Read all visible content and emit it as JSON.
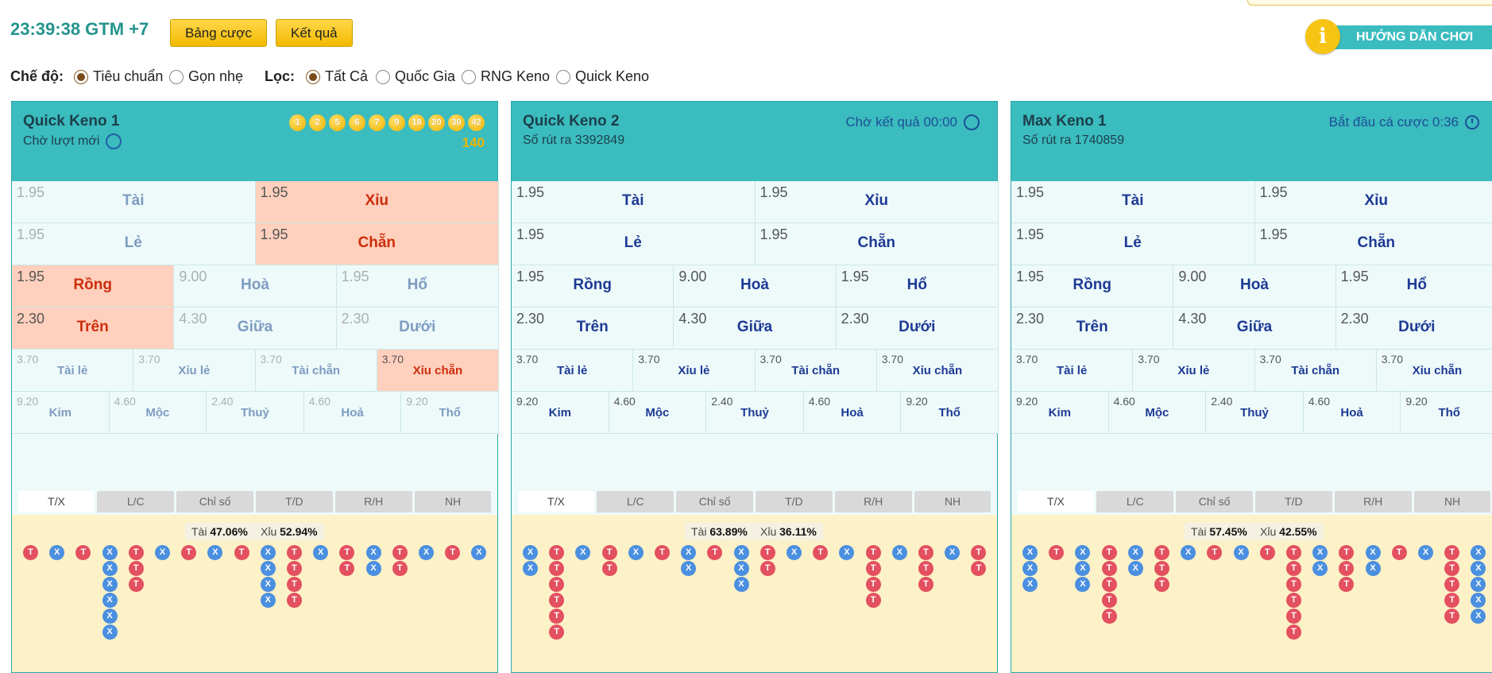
{
  "header": {
    "clock": "23:39:38 GTM +7",
    "bet_table_label": "Bảng cược",
    "results_label": "Kết quả",
    "help_label": "HƯỚNG DẪN CHƠI",
    "help_icon_glyph": "i"
  },
  "filters": {
    "mode_label": "Chế độ:",
    "mode_options": [
      {
        "label": "Tiêu chuẩn",
        "selected": true
      },
      {
        "label": "Gọn nhẹ",
        "selected": false
      }
    ],
    "filter_label": "Lọc:",
    "filter_options": [
      {
        "label": "Tất Cả",
        "selected": true
      },
      {
        "label": "Quốc Gia",
        "selected": false
      },
      {
        "label": "RNG Keno",
        "selected": false
      },
      {
        "label": "Quick Keno",
        "selected": false
      }
    ]
  },
  "colors": {
    "teal": "#3bbcbf",
    "selected_bg": "#ffd0bd",
    "selected_text": "#cc2e0c",
    "bet_text": "#1d3a94",
    "tai_bead": "#e35060",
    "xiu_bead": "#4a8fe0",
    "gold": "#f2b400"
  },
  "panels": [
    {
      "title": "Quick Keno 1",
      "subtitle": "Chờ lượt mới",
      "status": "",
      "balls": [
        "1",
        "2",
        "5",
        "6",
        "7",
        "9",
        "18",
        "20",
        "30",
        "42"
      ],
      "ball_sum": "140",
      "muted": true,
      "row1": [
        {
          "odds": "1.95",
          "name": "Tài",
          "sel": false
        },
        {
          "odds": "1.95",
          "name": "Xỉu",
          "sel": true
        }
      ],
      "row2": [
        {
          "odds": "1.95",
          "name": "Lẻ",
          "sel": false
        },
        {
          "odds": "1.95",
          "name": "Chẵn",
          "sel": true
        }
      ],
      "row3": [
        {
          "odds": "1.95",
          "name": "Rồng",
          "sel": true
        },
        {
          "odds": "9.00",
          "name": "Hoà",
          "sel": false
        },
        {
          "odds": "1.95",
          "name": "Hổ",
          "sel": false
        }
      ],
      "row4": [
        {
          "odds": "2.30",
          "name": "Trên",
          "sel": true
        },
        {
          "odds": "4.30",
          "name": "Giữa",
          "sel": false
        },
        {
          "odds": "2.30",
          "name": "Dưới",
          "sel": false
        }
      ],
      "row5": [
        {
          "odds": "3.70",
          "name": "Tài lẻ",
          "sel": false
        },
        {
          "odds": "3.70",
          "name": "Xỉu lẻ",
          "sel": false
        },
        {
          "odds": "3.70",
          "name": "Tài chẵn",
          "sel": false
        },
        {
          "odds": "3.70",
          "name": "Xỉu chẵn",
          "sel": true
        }
      ],
      "row6": [
        {
          "odds": "9.20",
          "name": "Kim",
          "sel": false
        },
        {
          "odds": "4.60",
          "name": "Mộc",
          "sel": false
        },
        {
          "odds": "2.40",
          "name": "Thuỷ",
          "sel": false
        },
        {
          "odds": "4.60",
          "name": "Hoả",
          "sel": false
        },
        {
          "odds": "9.20",
          "name": "Thổ",
          "sel": false
        }
      ],
      "tabs": [
        "T/X",
        "L/C",
        "Chỉ số",
        "T/D",
        "R/H",
        "NH"
      ],
      "tai_label": "Tài",
      "tai_pct": "47.06%",
      "xiu_label": "Xỉu",
      "xiu_pct": "52.94%",
      "road": [
        [
          "T"
        ],
        [
          "X"
        ],
        [
          "T"
        ],
        [
          "X",
          "X",
          "X",
          "X",
          "X",
          "X"
        ],
        [
          "T",
          "T",
          "T"
        ],
        [
          "X"
        ],
        [
          "T"
        ],
        [
          "X"
        ],
        [
          "T"
        ],
        [
          "X",
          "X",
          "X",
          "X"
        ],
        [
          "T",
          "T",
          "T",
          "T"
        ],
        [
          "X"
        ],
        [
          "T",
          "T"
        ],
        [
          "X",
          "X"
        ],
        [
          "T",
          "T"
        ],
        [
          "X"
        ],
        [
          "T"
        ],
        [
          "X"
        ]
      ]
    },
    {
      "title": "Quick Keno 2",
      "subtitle": "Số rút ra 3392849",
      "status": "Chờ kết quả 00:00",
      "balls": [],
      "ball_sum": "",
      "muted": false,
      "row1": [
        {
          "odds": "1.95",
          "name": "Tài",
          "sel": false
        },
        {
          "odds": "1.95",
          "name": "Xỉu",
          "sel": false
        }
      ],
      "row2": [
        {
          "odds": "1.95",
          "name": "Lẻ",
          "sel": false
        },
        {
          "odds": "1.95",
          "name": "Chẵn",
          "sel": false
        }
      ],
      "row3": [
        {
          "odds": "1.95",
          "name": "Rồng",
          "sel": false
        },
        {
          "odds": "9.00",
          "name": "Hoà",
          "sel": false
        },
        {
          "odds": "1.95",
          "name": "Hổ",
          "sel": false
        }
      ],
      "row4": [
        {
          "odds": "2.30",
          "name": "Trên",
          "sel": false
        },
        {
          "odds": "4.30",
          "name": "Giữa",
          "sel": false
        },
        {
          "odds": "2.30",
          "name": "Dưới",
          "sel": false
        }
      ],
      "row5": [
        {
          "odds": "3.70",
          "name": "Tài lẻ",
          "sel": false
        },
        {
          "odds": "3.70",
          "name": "Xỉu lẻ",
          "sel": false
        },
        {
          "odds": "3.70",
          "name": "Tài chẵn",
          "sel": false
        },
        {
          "odds": "3.70",
          "name": "Xỉu chẵn",
          "sel": false
        }
      ],
      "row6": [
        {
          "odds": "9.20",
          "name": "Kim",
          "sel": false
        },
        {
          "odds": "4.60",
          "name": "Mộc",
          "sel": false
        },
        {
          "odds": "2.40",
          "name": "Thuỷ",
          "sel": false
        },
        {
          "odds": "4.60",
          "name": "Hoả",
          "sel": false
        },
        {
          "odds": "9.20",
          "name": "Thổ",
          "sel": false
        }
      ],
      "tabs": [
        "T/X",
        "L/C",
        "Chỉ số",
        "T/D",
        "R/H",
        "NH"
      ],
      "tai_label": "Tài",
      "tai_pct": "63.89%",
      "xiu_label": "Xỉu",
      "xiu_pct": "36.11%",
      "road": [
        [
          "X",
          "X"
        ],
        [
          "T",
          "T",
          "T",
          "T",
          "T",
          "T"
        ],
        [
          "X"
        ],
        [
          "T",
          "T"
        ],
        [
          "X"
        ],
        [
          "T"
        ],
        [
          "X",
          "X"
        ],
        [
          "T"
        ],
        [
          "X",
          "X",
          "X"
        ],
        [
          "T",
          "T"
        ],
        [
          "X"
        ],
        [
          "T"
        ],
        [
          "X"
        ],
        [
          "T",
          "T",
          "T",
          "T"
        ],
        [
          "X"
        ],
        [
          "T",
          "T",
          "T"
        ],
        [
          "X"
        ],
        [
          "T",
          "T"
        ]
      ]
    },
    {
      "title": "Max Keno 1",
      "subtitle": "Số rút ra 1740859",
      "status": "Bắt đầu cá cược 0:36",
      "balls": [],
      "ball_sum": "",
      "muted": false,
      "row1": [
        {
          "odds": "1.95",
          "name": "Tài",
          "sel": false
        },
        {
          "odds": "1.95",
          "name": "Xỉu",
          "sel": false
        }
      ],
      "row2": [
        {
          "odds": "1.95",
          "name": "Lẻ",
          "sel": false
        },
        {
          "odds": "1.95",
          "name": "Chẵn",
          "sel": false
        }
      ],
      "row3": [
        {
          "odds": "1.95",
          "name": "Rồng",
          "sel": false
        },
        {
          "odds": "9.00",
          "name": "Hoà",
          "sel": false
        },
        {
          "odds": "1.95",
          "name": "Hổ",
          "sel": false
        }
      ],
      "row4": [
        {
          "odds": "2.30",
          "name": "Trên",
          "sel": false
        },
        {
          "odds": "4.30",
          "name": "Giữa",
          "sel": false
        },
        {
          "odds": "2.30",
          "name": "Dưới",
          "sel": false
        }
      ],
      "row5": [
        {
          "odds": "3.70",
          "name": "Tài lẻ",
          "sel": false
        },
        {
          "odds": "3.70",
          "name": "Xỉu lẻ",
          "sel": false
        },
        {
          "odds": "3.70",
          "name": "Tài chẵn",
          "sel": false
        },
        {
          "odds": "3.70",
          "name": "Xỉu chẵn",
          "sel": false
        }
      ],
      "row6": [
        {
          "odds": "9.20",
          "name": "Kim",
          "sel": false
        },
        {
          "odds": "4.60",
          "name": "Mộc",
          "sel": false
        },
        {
          "odds": "2.40",
          "name": "Thuỷ",
          "sel": false
        },
        {
          "odds": "4.60",
          "name": "Hoả",
          "sel": false
        },
        {
          "odds": "9.20",
          "name": "Thổ",
          "sel": false
        }
      ],
      "tabs": [
        "T/X",
        "L/C",
        "Chỉ số",
        "T/D",
        "R/H",
        "NH"
      ],
      "tai_label": "Tài",
      "tai_pct": "57.45%",
      "xiu_label": "Xỉu",
      "xiu_pct": "42.55%",
      "road": [
        [
          "X",
          "X",
          "X"
        ],
        [
          "T"
        ],
        [
          "X",
          "X",
          "X"
        ],
        [
          "T",
          "T",
          "T",
          "T",
          "T"
        ],
        [
          "X",
          "X"
        ],
        [
          "T",
          "T",
          "T"
        ],
        [
          "X"
        ],
        [
          "T"
        ],
        [
          "X"
        ],
        [
          "T"
        ],
        [
          "T",
          "T",
          "T",
          "T",
          "T",
          "T"
        ],
        [
          "X",
          "X"
        ],
        [
          "T",
          "T",
          "T"
        ],
        [
          "X",
          "X"
        ],
        [
          "T"
        ],
        [
          "X"
        ],
        [
          "T",
          "T",
          "T",
          "T",
          "T"
        ],
        [
          "X",
          "X",
          "X",
          "X",
          "X"
        ]
      ]
    }
  ]
}
